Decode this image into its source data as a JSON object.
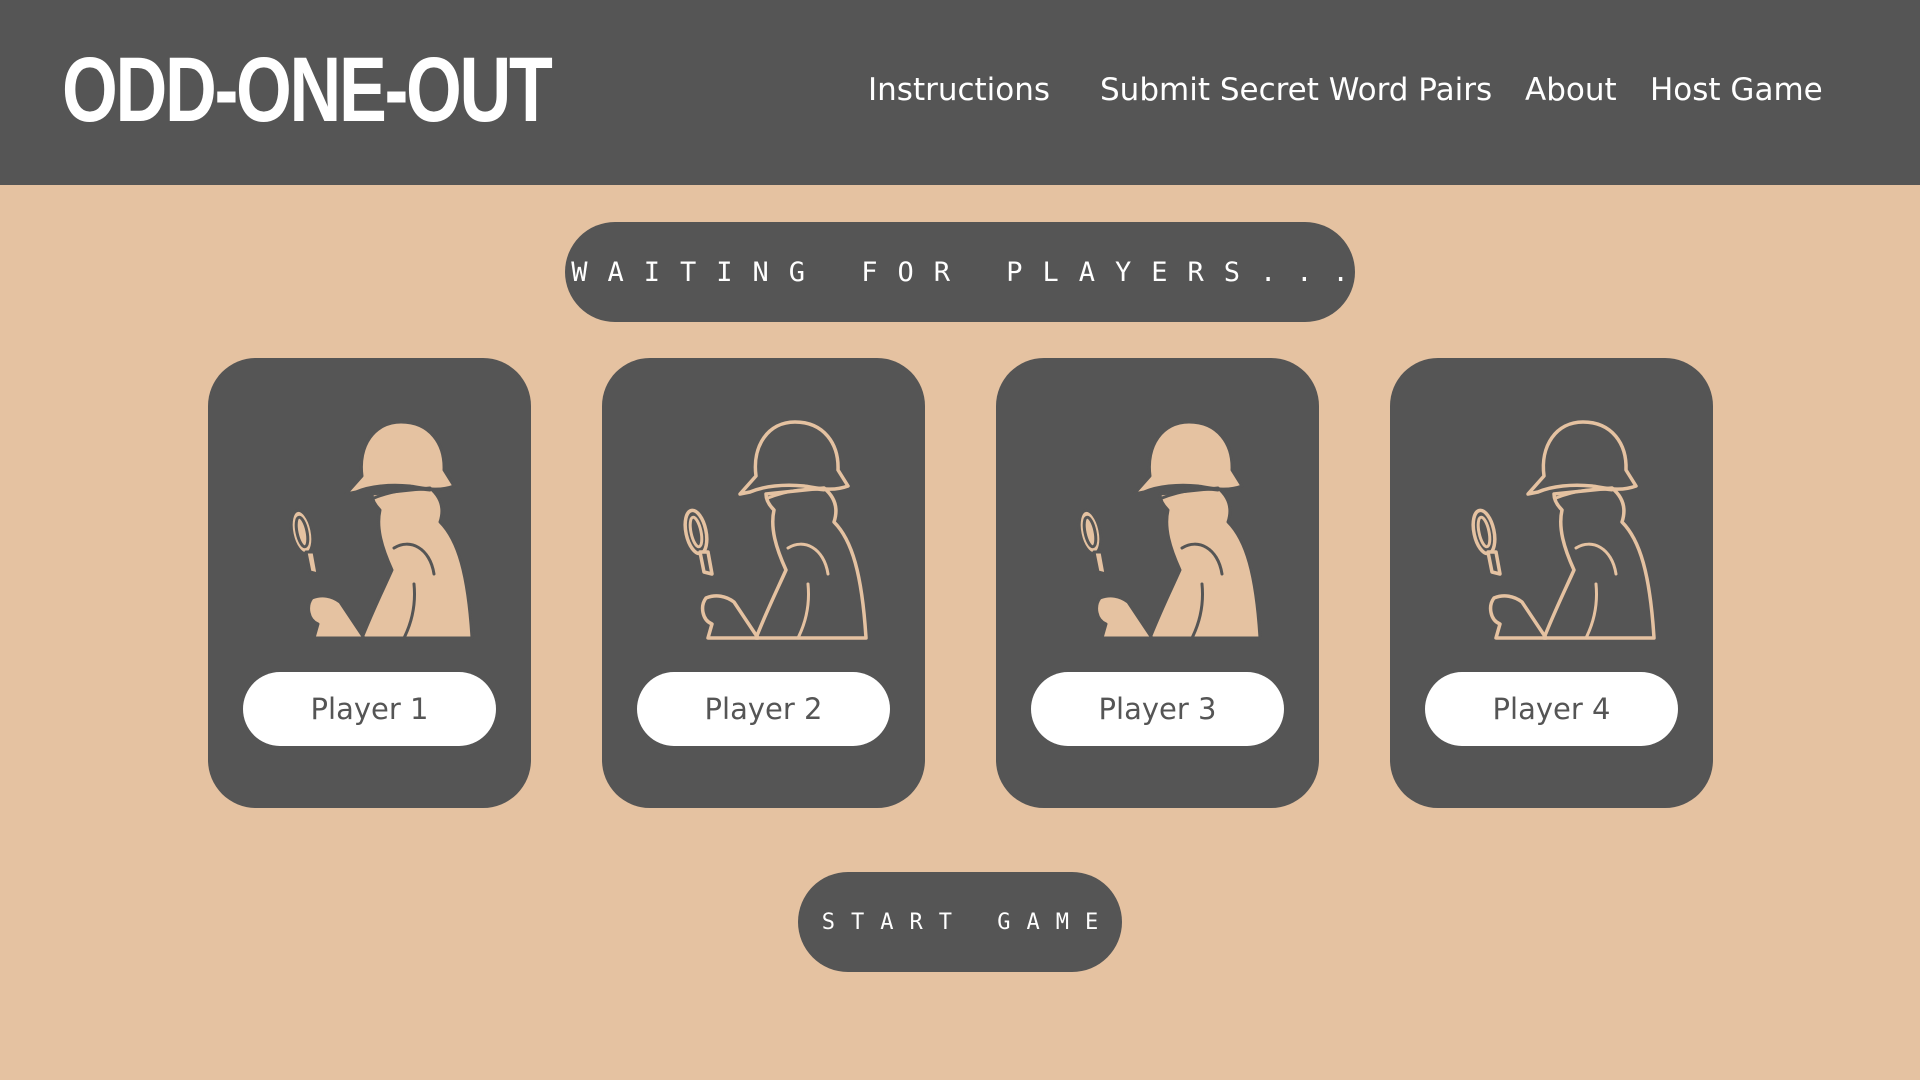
{
  "header": {
    "logo": "ODD-ONE-OUT",
    "nav": {
      "instructions": "Instructions",
      "submit_pairs": "Submit Secret Word Pairs",
      "about": "About",
      "host_game": "Host Game"
    }
  },
  "status": {
    "text": "WAITING FOR PLAYERS..."
  },
  "players": [
    {
      "label": "Player 1",
      "avatar": "detective-icon",
      "style": "filled"
    },
    {
      "label": "Player 2",
      "avatar": "detective-icon",
      "style": "outline"
    },
    {
      "label": "Player 3",
      "avatar": "detective-icon",
      "style": "filled"
    },
    {
      "label": "Player 4",
      "avatar": "detective-icon",
      "style": "outline"
    }
  ],
  "actions": {
    "start_game": "START GAME"
  },
  "colors": {
    "background": "#e5c2a1",
    "panel": "#555555",
    "text_light": "#ffffff",
    "accent": "#e5c2a1"
  }
}
